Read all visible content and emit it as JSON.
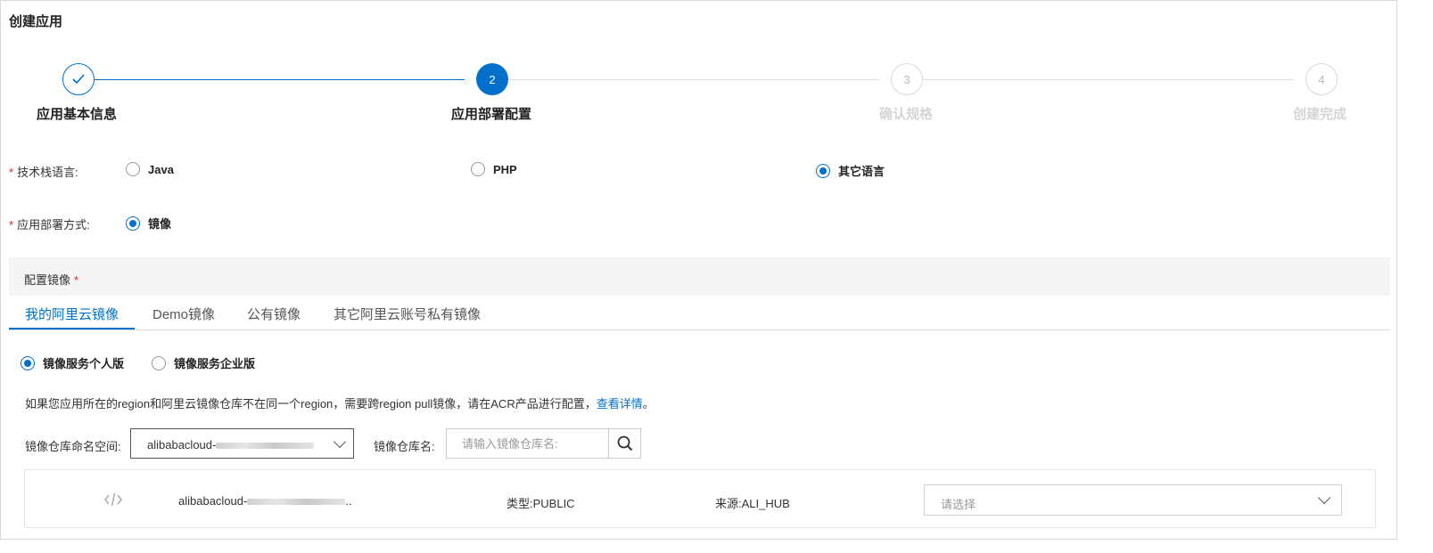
{
  "page_title": "创建应用",
  "steps": [
    {
      "index": "1",
      "label": "应用基本信息",
      "status": "done"
    },
    {
      "index": "2",
      "label": "应用部署配置",
      "status": "active"
    },
    {
      "index": "3",
      "label": "确认规格",
      "status": "todo"
    },
    {
      "index": "4",
      "label": "创建完成",
      "status": "todo"
    }
  ],
  "form": {
    "tech_stack": {
      "label": "技术栈语言:",
      "options": [
        "Java",
        "PHP",
        "其它语言"
      ],
      "selected": "其它语言"
    },
    "deploy_method": {
      "label": "应用部署方式:",
      "options": [
        "镜像"
      ],
      "selected": "镜像"
    }
  },
  "mirror_config": {
    "title": "配置镜像",
    "tabs": [
      "我的阿里云镜像",
      "Demo镜像",
      "公有镜像",
      "其它阿里云账号私有镜像"
    ],
    "active_tab": "我的阿里云镜像",
    "edition": {
      "options": [
        "镜像服务个人版",
        "镜像服务企业版"
      ],
      "selected": "镜像服务个人版"
    },
    "info_text": "如果您应用所在的region和阿里云镜像仓库不在同一个region，需要跨region pull镜像，请在ACR产品进行配置，",
    "info_link": "查看详情",
    "info_suffix": "。",
    "namespace_label": "镜像仓库命名空间:",
    "namespace_value": "alibabacloud-",
    "repo_name_label": "镜像仓库名:",
    "repo_name_placeholder": "请输入镜像仓库名:",
    "repo": {
      "icon": "code-icon",
      "name": "alibabacloud-",
      "name_suffix": "..",
      "type": "类型:PUBLIC",
      "source": "来源:ALI_HUB",
      "tag_placeholder": "请选择"
    }
  },
  "colors": {
    "primary": "#0070cc",
    "required": "#e2231a",
    "disabled_text": "#d5d5d5"
  }
}
